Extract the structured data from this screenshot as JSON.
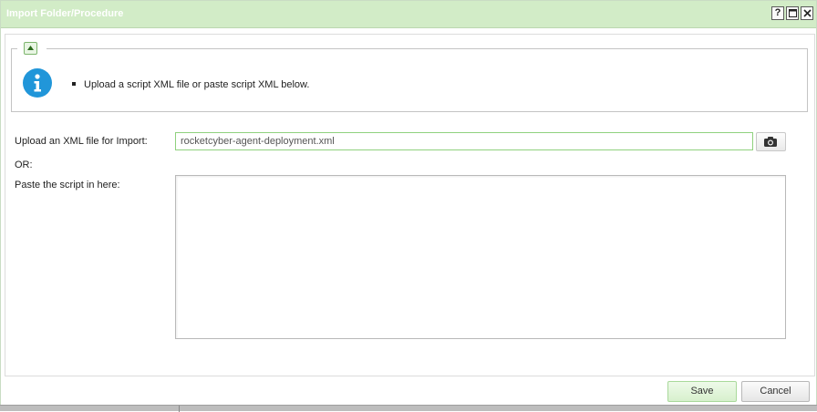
{
  "window": {
    "title": "Import Folder/Procedure",
    "controls": {
      "help": "?",
      "maximize": "",
      "close": ""
    }
  },
  "info": {
    "message": "Upload a script XML file or paste script XML below."
  },
  "form": {
    "upload_label": "Upload an XML file for Import:",
    "upload_value": "rocketcyber-agent-deployment.xml",
    "or_label": "OR:",
    "paste_label": "Paste the script in here:",
    "paste_value": ""
  },
  "footer": {
    "save_label": "Save",
    "cancel_label": "Cancel"
  },
  "colors": {
    "titlebar": "#d2ecc7",
    "info_icon": "#2196d9",
    "input_border": "#8fd17e"
  },
  "icons": {
    "collapse": "triangle-up-icon",
    "info": "info-icon",
    "upload": "camera-icon",
    "help": "help-icon",
    "maximize": "maximize-icon",
    "close": "close-icon"
  }
}
